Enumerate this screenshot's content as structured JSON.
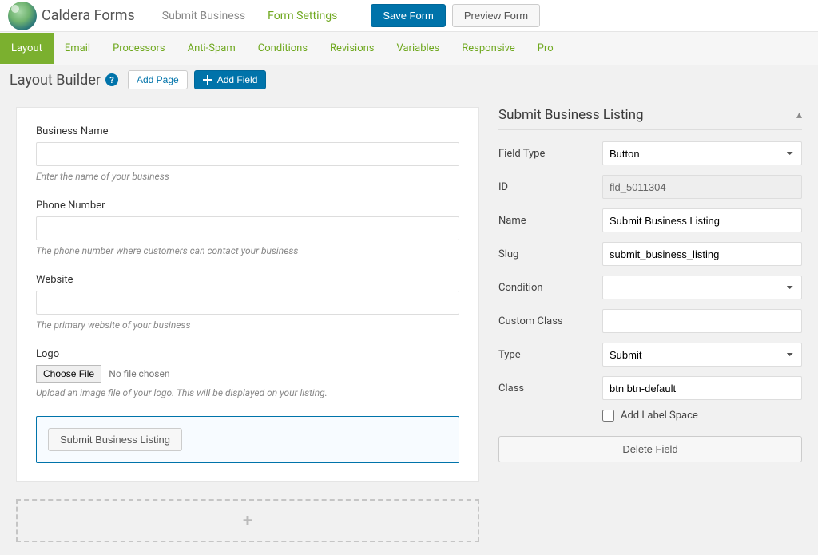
{
  "app_title": "Caldera Forms",
  "top_tabs": [
    "Submit Business",
    "Form Settings"
  ],
  "top_tab_active": 1,
  "top_buttons": {
    "save": "Save Form",
    "preview": "Preview Form"
  },
  "subnav": [
    "Layout",
    "Email",
    "Processors",
    "Anti-Spam",
    "Conditions",
    "Revisions",
    "Variables",
    "Responsive",
    "Pro"
  ],
  "subnav_active": 0,
  "builder": {
    "title": "Layout Builder",
    "add_page": "Add Page",
    "add_field": "Add Field"
  },
  "form_fields": [
    {
      "label": "Business Name",
      "hint": "Enter the name of your business",
      "type": "text"
    },
    {
      "label": "Phone Number",
      "hint": "The phone number where customers can contact your business",
      "type": "text"
    },
    {
      "label": "Website",
      "hint": "The primary website of your business",
      "type": "text"
    },
    {
      "label": "Logo",
      "hint": "Upload an image file of your logo. This will be displayed on your listing.",
      "type": "file",
      "file_btn": "Choose File",
      "file_status": "No file chosen"
    }
  ],
  "submit_field_label": "Submit Business Listing",
  "panel": {
    "title": "Submit Business Listing",
    "props": {
      "field_type_label": "Field Type",
      "field_type_value": "Button",
      "id_label": "ID",
      "id_value": "fld_5011304",
      "name_label": "Name",
      "name_value": "Submit Business Listing",
      "slug_label": "Slug",
      "slug_value": "submit_business_listing",
      "condition_label": "Condition",
      "condition_value": "",
      "custom_class_label": "Custom Class",
      "custom_class_value": "",
      "type_label": "Type",
      "type_value": "Submit",
      "class_label": "Class",
      "class_value": "btn btn-default",
      "add_label_space": "Add Label Space"
    },
    "delete_label": "Delete Field"
  }
}
